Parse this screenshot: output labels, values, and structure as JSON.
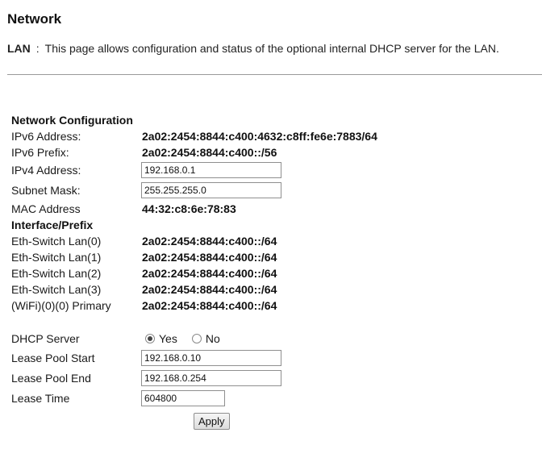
{
  "page": {
    "title": "Network",
    "section_name": "LAN",
    "separator": ":",
    "description": "This page allows configuration and status of the optional internal DHCP server for the LAN."
  },
  "network_config": {
    "heading": "Network Configuration",
    "ipv6_address_label": "IPv6 Address:",
    "ipv6_address_value": "2a02:2454:8844:c400:4632:c8ff:fe6e:7883/64",
    "ipv6_prefix_label": "IPv6 Prefix:",
    "ipv6_prefix_value": "2a02:2454:8844:c400::/56",
    "ipv4_address_label": "IPv4 Address:",
    "ipv4_address_value": "192.168.0.1",
    "subnet_mask_label": "Subnet Mask:",
    "subnet_mask_value": "255.255.255.0",
    "mac_address_label": "MAC Address",
    "mac_address_value": "44:32:c8:6e:78:83"
  },
  "interface_prefix": {
    "heading": "Interface/Prefix",
    "items": [
      {
        "label": "Eth-Switch Lan(0)",
        "value": "2a02:2454:8844:c400::/64"
      },
      {
        "label": "Eth-Switch Lan(1)",
        "value": "2a02:2454:8844:c400::/64"
      },
      {
        "label": "Eth-Switch Lan(2)",
        "value": "2a02:2454:8844:c400::/64"
      },
      {
        "label": "Eth-Switch Lan(3)",
        "value": "2a02:2454:8844:c400::/64"
      },
      {
        "label": "(WiFi)(0)(0) Primary",
        "value": "2a02:2454:8844:c400::/64"
      }
    ]
  },
  "dhcp": {
    "server_label": "DHCP Server",
    "yes_label": "Yes",
    "no_label": "No",
    "selected": "Yes",
    "lease_pool_start_label": "Lease Pool Start",
    "lease_pool_start_value": "192.168.0.10",
    "lease_pool_end_label": "Lease Pool End",
    "lease_pool_end_value": "192.168.0.254",
    "lease_time_label": "Lease Time",
    "lease_time_value": "604800"
  },
  "actions": {
    "apply_label": "Apply"
  },
  "icons": {
    "radio_selected": "radio-selected-icon",
    "radio_unselected": "radio-unselected-icon"
  }
}
